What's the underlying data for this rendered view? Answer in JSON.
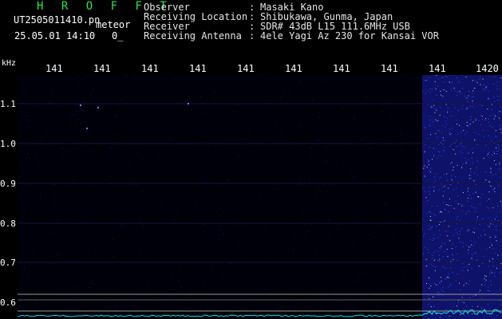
{
  "header": {
    "app_title": "H R O F F T",
    "filename": "UT2505011410.pn",
    "mode_tag": "meteor",
    "timestamp": "25.05.01 14:10",
    "count": "0_"
  },
  "info": [
    {
      "label": "Observer",
      "value": "Masaki Kano"
    },
    {
      "label": "Receiving Location",
      "value": "Shibukawa, Gunma, Japan"
    },
    {
      "label": "Receiver",
      "value": "SDR# 43dB L15 111.6MHz USB"
    },
    {
      "label": "Receiving Antenna",
      "value": "4ele Yagi Az 230 for Kansai VOR"
    }
  ],
  "axes": {
    "freq_unit": "kHz",
    "x_ticks": [
      "141",
      "141",
      "141",
      "141",
      "141",
      "141",
      "141",
      "141",
      "141",
      "1420"
    ],
    "y_ticks": [
      "1.1",
      "1.0",
      "0.9",
      "0.8",
      "0.7",
      "0.6"
    ]
  },
  "colors": {
    "background": "#000000",
    "title": "#2fe04a",
    "signal_band": "#2730e0",
    "baseline": "#00e5e5"
  }
}
